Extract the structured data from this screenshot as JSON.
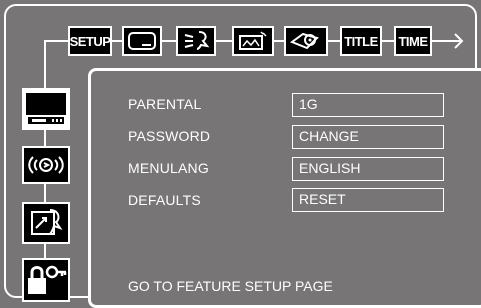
{
  "colors": {
    "background": "#777575",
    "foreground": "#ffffff",
    "icon_fill": "#000000"
  },
  "tabs": [
    {
      "label": "SETUP",
      "icon": "setup-text"
    },
    {
      "label": "",
      "icon": "tv-screen-icon"
    },
    {
      "label": "",
      "icon": "audio-speech-icon"
    },
    {
      "label": "",
      "icon": "video-image-icon"
    },
    {
      "label": "",
      "icon": "disc-book-icon"
    },
    {
      "label": "TITLE",
      "icon": "title-text"
    },
    {
      "label": "TIME",
      "icon": "time-text"
    }
  ],
  "side_menu": [
    {
      "icon": "tv-display-icon",
      "active": true
    },
    {
      "icon": "audio-surround-icon",
      "active": false
    },
    {
      "icon": "speech-language-icon",
      "active": false
    },
    {
      "icon": "lock-key-icon",
      "active": false
    }
  ],
  "settings": [
    {
      "label": "PARENTAL",
      "value": "1G"
    },
    {
      "label": "PASSWORD",
      "value": "CHANGE"
    },
    {
      "label": "MENULANG",
      "value": "ENGLISH"
    },
    {
      "label": "DEFAULTS",
      "value": "RESET"
    }
  ],
  "footer": "GO TO FEATURE SETUP PAGE"
}
